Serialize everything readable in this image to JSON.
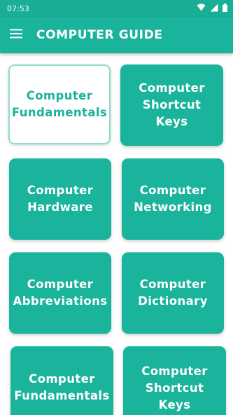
{
  "status": {
    "time": "07:53"
  },
  "appbar": {
    "title": "COMPUTER GUIDE"
  },
  "colors": {
    "primary": "#1ab39b",
    "statusbar": "#1aae96",
    "selected_border": "#8fddd0"
  },
  "icons": {
    "menu": "menu-icon",
    "wifi": "wifi-icon",
    "signal": "signal-icon",
    "battery": "battery-icon"
  },
  "cards": [
    {
      "lines": [
        "Computer",
        "Fundamentals"
      ],
      "selected": true
    },
    {
      "lines": [
        "Computer",
        "Shortcut",
        "Keys"
      ],
      "selected": false
    },
    {
      "lines": [
        "Computer",
        "Hardware"
      ],
      "selected": false
    },
    {
      "lines": [
        "Computer",
        "Networking"
      ],
      "selected": false
    },
    {
      "lines": [
        "Computer",
        "Abbreviations"
      ],
      "selected": false
    },
    {
      "lines": [
        "Computer",
        "Dictionary"
      ],
      "selected": false
    },
    {
      "lines": [
        "Computer",
        "Fundamentals"
      ],
      "selected": false
    },
    {
      "lines": [
        "Computer",
        "Shortcut",
        "Keys"
      ],
      "selected": false
    }
  ]
}
